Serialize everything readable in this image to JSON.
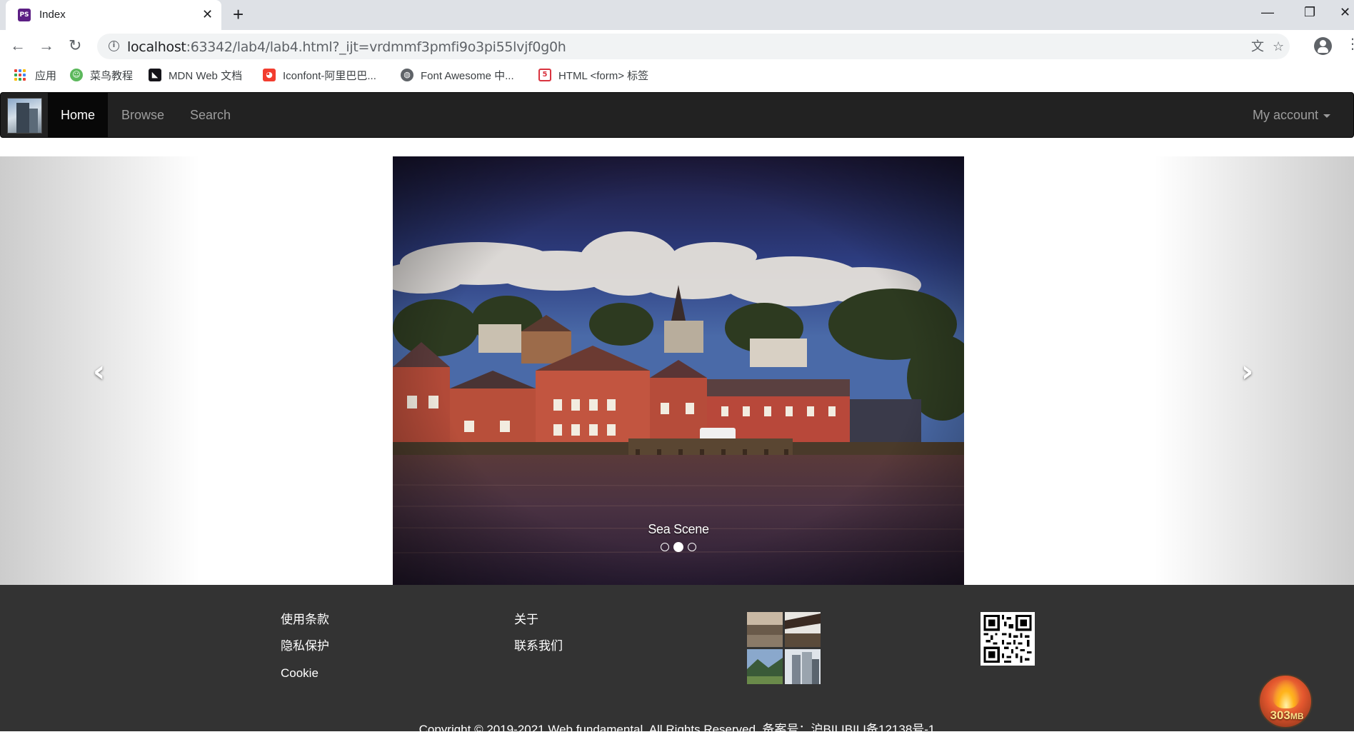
{
  "browser": {
    "tab_title": "Index",
    "tab_favicon_text": "PS",
    "url_host": "localhost",
    "url_path": ":63342/lab4/lab4.html?_ijt=vrdmmf3pmfi9o3pi55lvjf0g0h",
    "bookmarks": [
      {
        "label": "应用",
        "icon": "apps-grid-icon",
        "color": "#4285f4"
      },
      {
        "label": "菜鸟教程",
        "icon": "runoob-icon",
        "color": "#5cb85c"
      },
      {
        "label": "MDN Web 文档",
        "icon": "mdn-icon",
        "color": "#15141a"
      },
      {
        "label": "Iconfont-阿里巴巴...",
        "icon": "iconfont-icon",
        "color": "#f23d2f"
      },
      {
        "label": "Font Awesome 中...",
        "icon": "globe-icon",
        "color": "#5f6368"
      },
      {
        "label": "HTML <form> 标签",
        "icon": "w3school-icon",
        "color": "#d9333f"
      }
    ]
  },
  "site": {
    "nav": {
      "items": [
        "Home",
        "Browse",
        "Search"
      ],
      "active": "Home",
      "account_label": "My account"
    },
    "carousel": {
      "caption": "Sea Scene",
      "slide_count": 3,
      "active_index": 1
    },
    "footer": {
      "col1": [
        "使用条款",
        "隐私保护",
        "Cookie"
      ],
      "col2": [
        "关于",
        "联系我们"
      ],
      "copyright": "Copyright © 2019-2021 Web fundamental. All Rights Reserved. 备案号：沪BILIBILI备12138号-1"
    }
  },
  "overlay": {
    "memory_value": "303",
    "memory_unit": "MB"
  },
  "colors": {
    "navbar": "#222222",
    "navbar_active": "#080808",
    "footer": "#333333",
    "link": "#9d9d9d"
  }
}
